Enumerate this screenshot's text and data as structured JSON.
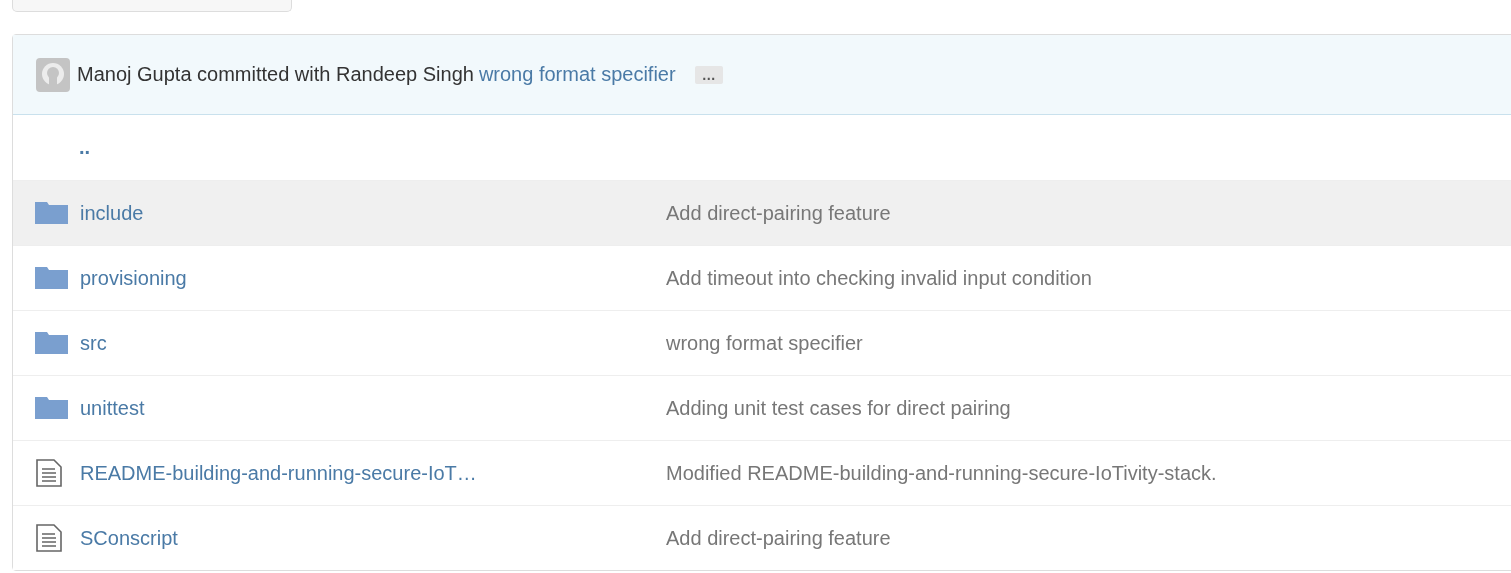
{
  "commit": {
    "author": "Manoj Gupta",
    "verb": "committed with",
    "coauthor": "Randeep Singh",
    "message": "wrong format specifier",
    "more": "…"
  },
  "parent_link": "..",
  "files": [
    {
      "kind": "folder",
      "name": "include",
      "message": "Add direct-pairing feature",
      "highlighted": true
    },
    {
      "kind": "folder",
      "name": "provisioning",
      "message": "Add timeout into checking invalid input condition",
      "highlighted": false
    },
    {
      "kind": "folder",
      "name": "src",
      "message": "wrong format specifier",
      "highlighted": false
    },
    {
      "kind": "folder",
      "name": "unittest",
      "message": "Adding unit test cases for direct pairing",
      "highlighted": false
    },
    {
      "kind": "file",
      "name": "README-building-and-running-secure-IoT…",
      "message": "Modified README-building-and-running-secure-IoTivity-stack.",
      "highlighted": false
    },
    {
      "kind": "file",
      "name": "SConscript",
      "message": "Add direct-pairing feature",
      "highlighted": false
    }
  ]
}
